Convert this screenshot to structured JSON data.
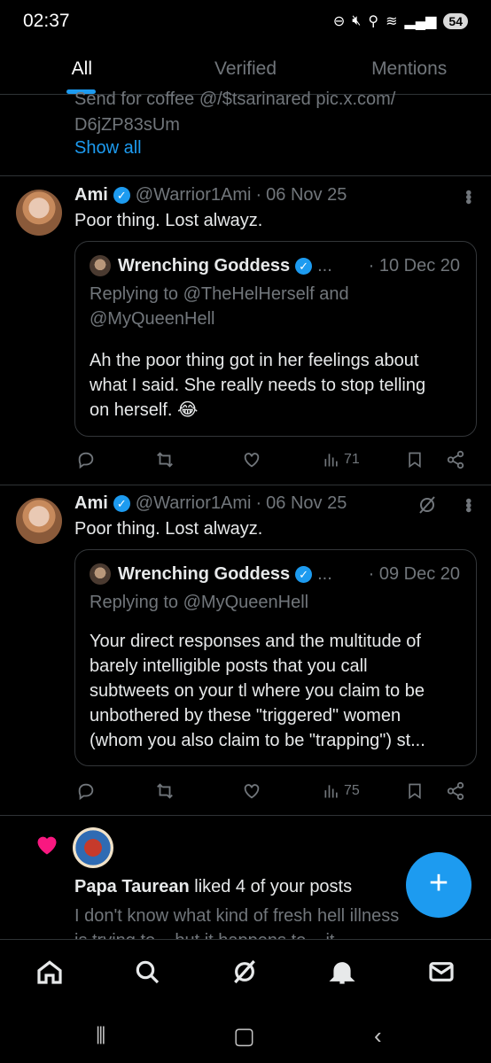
{
  "status": {
    "time": "02:37",
    "battery": "54"
  },
  "tabs": [
    {
      "label": "All",
      "active": true
    },
    {
      "label": "Verified",
      "active": false
    },
    {
      "label": "Mentions",
      "active": false
    }
  ],
  "prev_tweet": {
    "text_line1": "Send for coffee @/$tsarinared pic.x.com/",
    "text_line2": "D6jZP83sUm",
    "show_all": "Show all"
  },
  "tweets": [
    {
      "name": "Ami",
      "handle": "@Warrior1Ami",
      "sep": "·",
      "date": "06 Nov 25",
      "text": "Poor thing. Lost alwayz.",
      "quote": {
        "name": "Wrenching Goddess",
        "ellipsis": "...",
        "date": "· 10 Dec 20",
        "reply_line1": "Replying to @TheHelHerself and",
        "reply_line2": "@MyQueenHell",
        "text_lines": [
          "Ah the poor thing got in her feelings about",
          "what I said. She really needs to stop telling",
          "on herself. 😂"
        ]
      },
      "views": "71"
    },
    {
      "name": "Ami",
      "handle": "@Warrior1Ami",
      "sep": "·",
      "date": "06 Nov 25",
      "text": "Poor thing. Lost alwayz.",
      "quote": {
        "name": "Wrenching Goddess",
        "ellipsis": "...",
        "date": "· 09 Dec 20",
        "reply_line1": "Replying to @MyQueenHell",
        "text_lines": [
          "Your direct responses and the multitude of",
          "barely intelligible posts that you call",
          "subtweets on your tl where you claim to be",
          "unbothered by these \"triggered\" women",
          "(whom you also claim to be \"trapping\") st..."
        ]
      },
      "views": "75"
    }
  ],
  "notification": {
    "user": "Papa Taurean",
    "action": " liked 4 of your posts",
    "preview_line1": "I don't know what kind of fresh hell illness",
    "preview_line2": "is trying to... but it happens to... it..."
  },
  "colors": {
    "accent": "#1d9bf0",
    "like": "#f91880",
    "background": "#000000",
    "muted": "#71767b"
  },
  "icons": {
    "nav": [
      "home-icon",
      "search-icon",
      "grok-icon",
      "notifications-icon",
      "messages-icon"
    ],
    "actions": [
      "reply-icon",
      "retweet-icon",
      "like-icon",
      "views-icon",
      "bookmark-icon",
      "share-icon"
    ]
  }
}
